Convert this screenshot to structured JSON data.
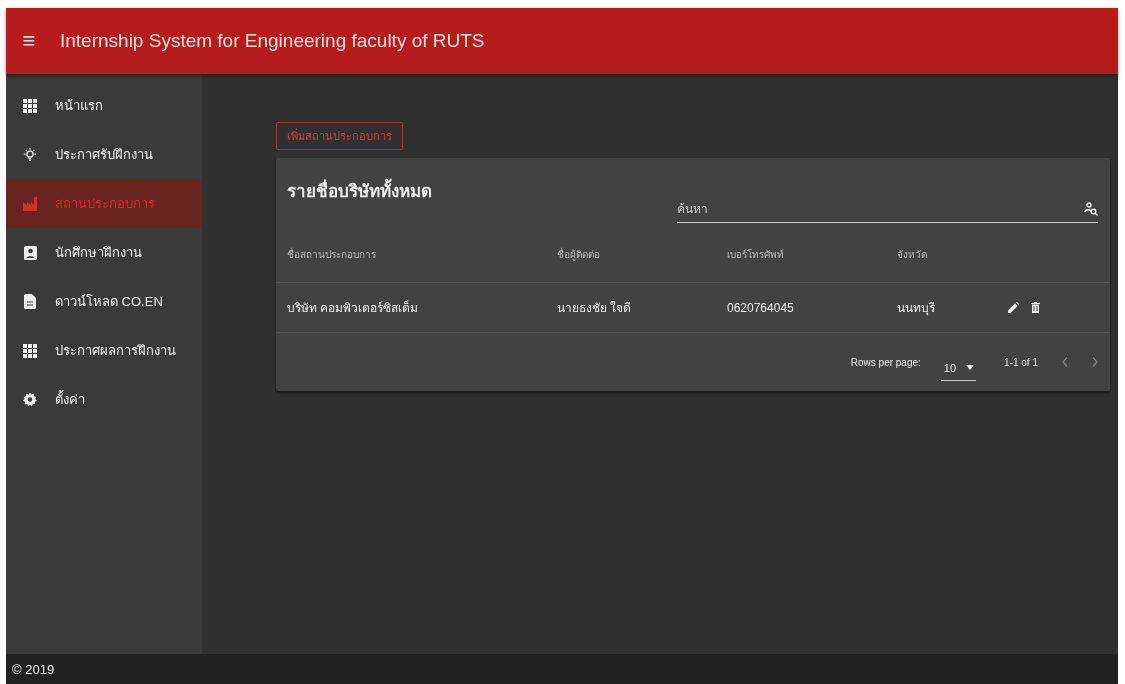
{
  "app_bar": {
    "menu_icon": "≡",
    "title": "Internship System for Engineering faculty of RUTS"
  },
  "sidebar": {
    "items": [
      {
        "label": "หน้าแรก",
        "selected": false
      },
      {
        "label": "ประกาศรับฝึกงาน",
        "selected": false
      },
      {
        "label": "สถานประกอบการ",
        "selected": true
      },
      {
        "label": "นักศึกษาฝึกงาน",
        "selected": false
      },
      {
        "label": "ดาวน์โหลด CO.EN",
        "selected": false
      },
      {
        "label": "ประกาศผลการฝึกงาน",
        "selected": false
      },
      {
        "label": "ตั้งค่า",
        "selected": false
      }
    ]
  },
  "add_button": "เพิ่มสถานประกอบการ",
  "table": {
    "title": "รายชื่อบริษัททั้งหมด",
    "search": {
      "placeholder": "ค้นหา"
    },
    "columns": [
      "ชื่อสถานประกอบการ",
      "ชื่อผู้ติดต่อ",
      "เบอร์โทรศัพท์",
      "จังหวัด"
    ],
    "rows": [
      {
        "cells": [
          "บริษัท คอมพิวเตอร์ซิสเต็ม",
          "นายธงชัย ใจดี",
          "0620764045",
          "นนทบุรี"
        ]
      }
    ],
    "pagination": {
      "rows_per_page_label": "Rows per page:",
      "rows_per_page": "10",
      "range": "1-1 of 1"
    }
  },
  "footer": "© 2019"
}
